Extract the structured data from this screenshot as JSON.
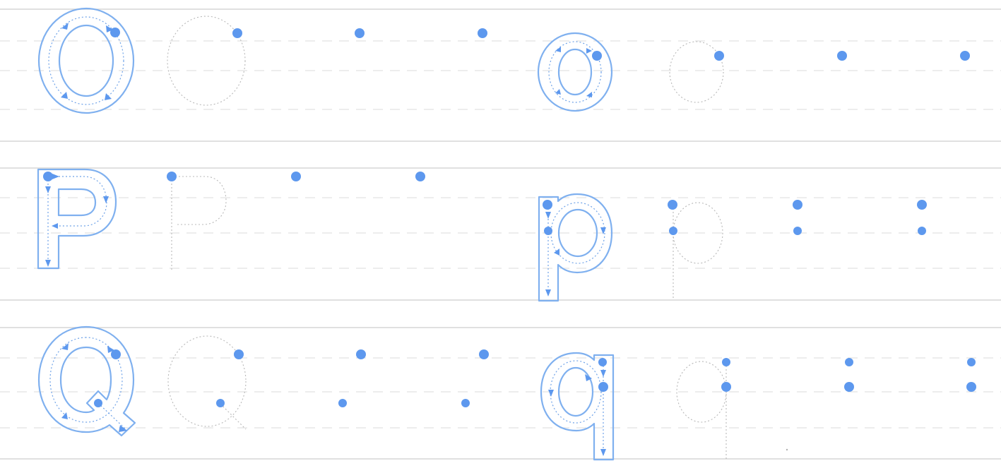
{
  "worksheet": {
    "rows": [
      {
        "uppercase": "O",
        "lowercase": "o"
      },
      {
        "uppercase": "P",
        "lowercase": "p"
      },
      {
        "uppercase": "Q",
        "lowercase": "q"
      }
    ]
  },
  "colors": {
    "guide_blue": "#5d98ee",
    "outline_blue": "#7fb0ef",
    "trace_gray": "#b8b8b8",
    "rule_gray": "#d6d6d6"
  },
  "icons": [
    "start-dot",
    "direction-arrow"
  ]
}
